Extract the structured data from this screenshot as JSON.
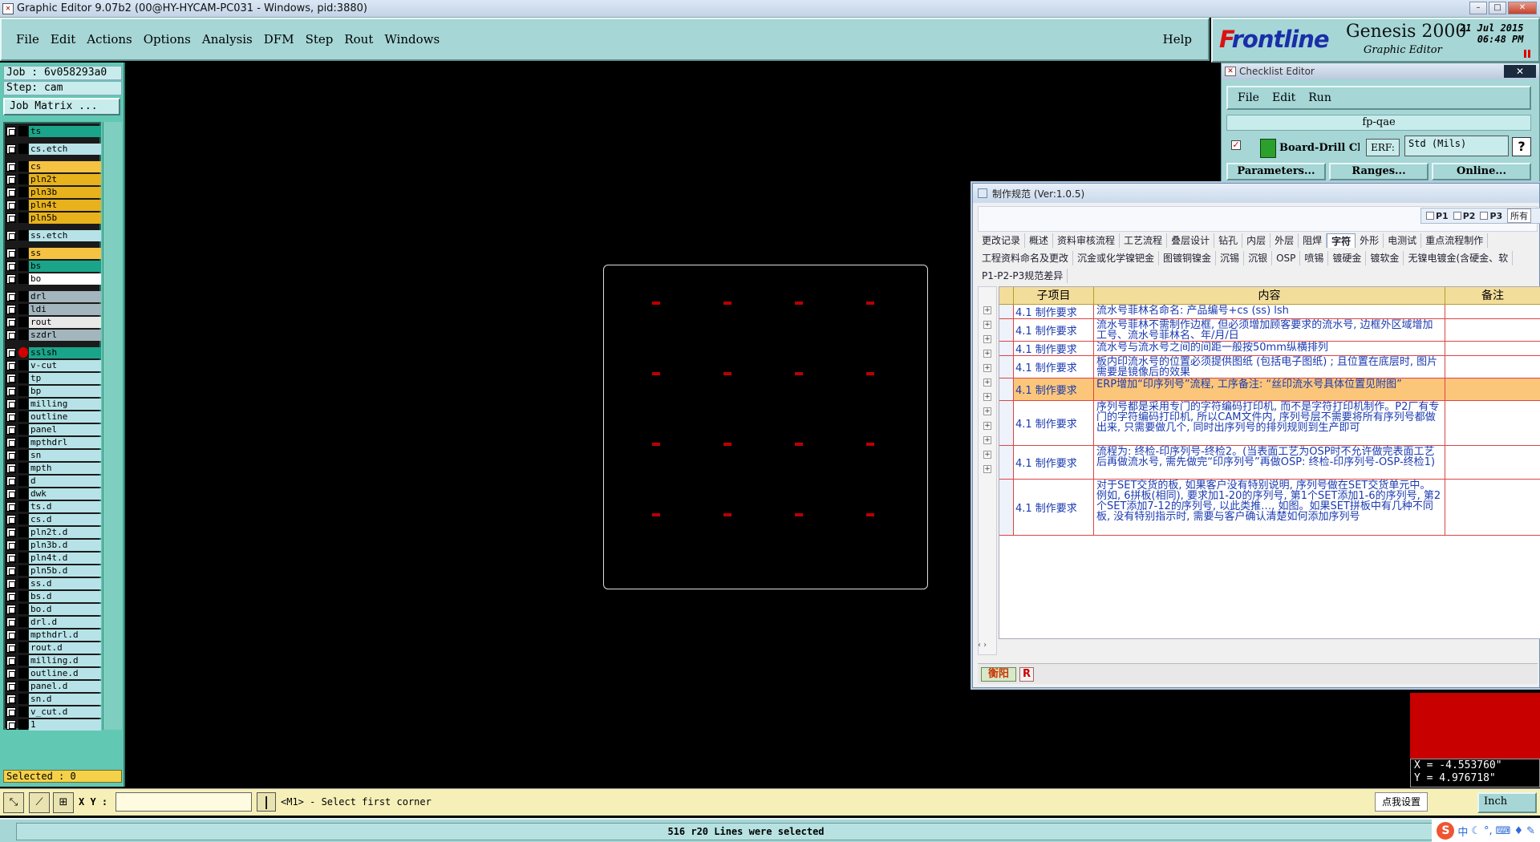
{
  "window": {
    "title": "Graphic Editor 9.07b2 (00@HY-HYCAM-PC031 - Windows, pid:3880)",
    "buttons": [
      "–",
      "□",
      "✕"
    ]
  },
  "menu": {
    "items": [
      "File",
      "Edit",
      "Actions",
      "Options",
      "Analysis",
      "DFM",
      "Step",
      "Rout",
      "Windows"
    ],
    "help": "Help"
  },
  "brand": {
    "logo_prefix": "F",
    "logo_rest": "rontline",
    "product": "Genesis 2000",
    "subtitle": "Graphic Editor",
    "date": "21 Jul 2015",
    "time": "06:48 PM"
  },
  "job": {
    "job_label": "Job : 6v058293a0",
    "step_label": "Step: cam",
    "matrix_button": "Job Matrix ..."
  },
  "layers": [
    {
      "name": "ts",
      "color": "#1aa58a",
      "sw": "#000000"
    },
    {
      "name": "cs.etch",
      "color": "#b7e3e8",
      "sw": "#000000"
    },
    {
      "name": "cs",
      "color": "#f5c242",
      "sw": "#000000"
    },
    {
      "name": "pln2t",
      "color": "#e7b21c",
      "sw": "#000000"
    },
    {
      "name": "pln3b",
      "color": "#e7b21c",
      "sw": "#000000"
    },
    {
      "name": "pln4t",
      "color": "#e7b21c",
      "sw": "#000000"
    },
    {
      "name": "pln5b",
      "color": "#e7b21c",
      "sw": "#000000"
    },
    {
      "name": "ss.etch",
      "color": "#b7e3e8",
      "sw": "#000000"
    },
    {
      "name": "ss",
      "color": "#f5c242",
      "sw": "#000000"
    },
    {
      "name": "bs",
      "color": "#1aa58a",
      "sw": "#000000"
    },
    {
      "name": "bo",
      "color": "#ffffff",
      "sw": "#000000"
    },
    {
      "name": "drl",
      "color": "#a3b6bd",
      "sw": "#000000"
    },
    {
      "name": "ldi",
      "color": "#a3b6bd",
      "sw": "#000000"
    },
    {
      "name": "rout",
      "color": "#e8e8e8",
      "sw": "#000000"
    },
    {
      "name": "szdrl",
      "color": "#a3b6bd",
      "sw": "#000000"
    },
    {
      "name": "sslsh",
      "color": "#1aa58a",
      "sw": "#d40000"
    },
    {
      "name": "v-cut",
      "color": "#b7e3e8",
      "sw": "#000000"
    },
    {
      "name": "tp",
      "color": "#b7e3e8",
      "sw": "#000000"
    },
    {
      "name": "bp",
      "color": "#b7e3e8",
      "sw": "#000000"
    },
    {
      "name": "milling",
      "color": "#b7e3e8",
      "sw": "#000000"
    },
    {
      "name": "outline",
      "color": "#b7e3e8",
      "sw": "#000000"
    },
    {
      "name": "panel",
      "color": "#b7e3e8",
      "sw": "#000000"
    },
    {
      "name": "mpthdrl",
      "color": "#b7e3e8",
      "sw": "#000000"
    },
    {
      "name": "sn",
      "color": "#b7e3e8",
      "sw": "#000000"
    },
    {
      "name": "mpth",
      "color": "#b7e3e8",
      "sw": "#000000"
    },
    {
      "name": "d",
      "color": "#b7e3e8",
      "sw": "#000000"
    },
    {
      "name": "dwk",
      "color": "#b7e3e8",
      "sw": "#000000"
    },
    {
      "name": "ts.d",
      "color": "#b7e3e8",
      "sw": "#000000"
    },
    {
      "name": "cs.d",
      "color": "#b7e3e8",
      "sw": "#000000"
    },
    {
      "name": "pln2t.d",
      "color": "#b7e3e8",
      "sw": "#000000"
    },
    {
      "name": "pln3b.d",
      "color": "#b7e3e8",
      "sw": "#000000"
    },
    {
      "name": "pln4t.d",
      "color": "#b7e3e8",
      "sw": "#000000"
    },
    {
      "name": "pln5b.d",
      "color": "#b7e3e8",
      "sw": "#000000"
    },
    {
      "name": "ss.d",
      "color": "#b7e3e8",
      "sw": "#000000"
    },
    {
      "name": "bs.d",
      "color": "#b7e3e8",
      "sw": "#000000"
    },
    {
      "name": "bo.d",
      "color": "#b7e3e8",
      "sw": "#000000"
    },
    {
      "name": "drl.d",
      "color": "#b7e3e8",
      "sw": "#000000"
    },
    {
      "name": "mpthdrl.d",
      "color": "#b7e3e8",
      "sw": "#000000"
    },
    {
      "name": "rout.d",
      "color": "#b7e3e8",
      "sw": "#000000"
    },
    {
      "name": "milling.d",
      "color": "#b7e3e8",
      "sw": "#000000"
    },
    {
      "name": "outline.d",
      "color": "#b7e3e8",
      "sw": "#000000"
    },
    {
      "name": "panel.d",
      "color": "#b7e3e8",
      "sw": "#000000"
    },
    {
      "name": "sn.d",
      "color": "#b7e3e8",
      "sw": "#000000"
    },
    {
      "name": "v_cut.d",
      "color": "#b7e3e8",
      "sw": "#000000"
    },
    {
      "name": "1",
      "color": "#b7e3e8",
      "sw": "#000000"
    }
  ],
  "selected_label": "Selected : 0",
  "checklist": {
    "title": "Checklist Editor",
    "close": "✕",
    "menu": [
      "File",
      "Edit",
      "Run"
    ],
    "name": "fp-qae",
    "action": "Board-Drill Che",
    "erf_label": "ERF:",
    "erf_value": "Std (Mils)",
    "help": "?",
    "buttons": [
      "Parameters...",
      "Ranges...",
      "Online..."
    ]
  },
  "coords": {
    "x": "X = -4.553760\"",
    "y": "Y = 4.976718\""
  },
  "dialog": {
    "title": "制作规范 (Ver:1.0.5)",
    "pchecks": [
      "P1",
      "P2",
      "P3"
    ],
    "all_label": "所有",
    "tabs_row1": [
      "更改记录",
      "概述",
      "资料审核流程",
      "工艺流程",
      "叠层设计",
      "钻孔",
      "内层",
      "外层",
      "阻焊",
      "字符",
      "外形",
      "电测试",
      "重点流程制作"
    ],
    "tabs_row2": [
      "工程资料命名及更改",
      "沉金或化学镍钯金",
      "图镀铜镍金",
      "沉锡",
      "沉银",
      "OSP",
      "喷锡",
      "镀硬金",
      "镀软金",
      "无镍电镀金(含硬金、软"
    ],
    "tabs_row3": [
      "P1-P2-P3规范差异"
    ],
    "columns": [
      "子项目",
      "内容",
      "备注"
    ],
    "rows": [
      {
        "item": "4.1 制作要求",
        "text": "流水号菲林名命名: 产品编号+cs (ss) lsh"
      },
      {
        "item": "4.1 制作要求",
        "text": "流水号菲林不需制作边框, 但必须增加顾客要求的流水号, 边框外区域增加工号、流水号菲林名、年/月/日"
      },
      {
        "item": "4.1 制作要求",
        "text": "流水号与流水号之间的间距一般按50mm纵横排列"
      },
      {
        "item": "4.1 制作要求",
        "text": "板内印流水号的位置必须提供图纸 (包括电子图纸) ; 且位置在底层时, 图片需要是镜像后的效果"
      },
      {
        "item": "4.1 制作要求",
        "text": "ERP增加“印序列号”流程, 工序备注: “丝印流水号具体位置见附图”"
      },
      {
        "item": "4.1 制作要求",
        "text": "序列号都是采用专门的字符编码打印机, 而不是字符打印机制作。P2厂有专门的字符编码打印机, 所以CAM文件内, 序列号层不需要将所有序列号都做出来, 只需要做几个, 同时出序列号的排列规则到生产即可"
      },
      {
        "item": "4.1 制作要求",
        "text": "流程为: 终检-印序列号-终检2。(当表面工艺为OSP时不允许做完表面工艺后再做流水号, 需先做完“印序列号”再做OSP: 终检-印序列号-OSP-终检1)"
      },
      {
        "item": "4.1 制作要求",
        "text": "对于SET交货的板, 如果客户没有特别说明, 序列号做在SET交货单元中。 例如, 6拼板(相同), 要求加1-20的序列号, 第1个SET添加1-6的序列号, 第2个SET添加7-12的序列号, 以此类推…, 如图。如果SET拼板中有几种不同板, 没有特别指示时, 需要与客户确认清楚如何添加序列号"
      }
    ],
    "footer_left": "衡阳",
    "footer_r": "R"
  },
  "command": {
    "xy_label": "X Y :",
    "xy_value": "",
    "message": "<M1> - Select first corner",
    "hint_button": "点我设置",
    "unit": "Inch"
  },
  "status": {
    "text": "516 r20 Lines were selected"
  },
  "tray": {
    "logo": "S",
    "ime": "中"
  }
}
